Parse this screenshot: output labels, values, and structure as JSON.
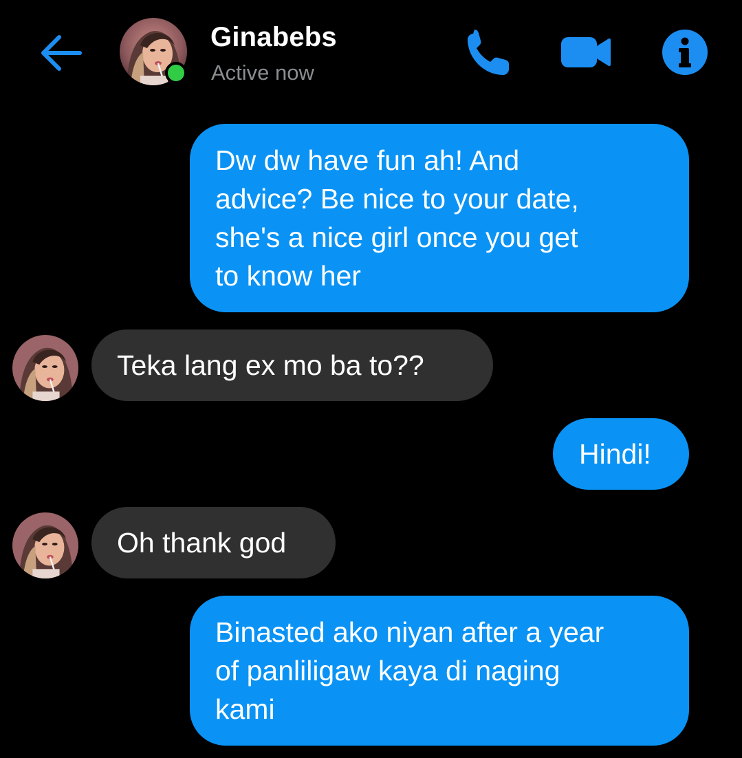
{
  "header": {
    "contact_name": "Ginabebs",
    "status": "Active now",
    "icons": {
      "back": "back-arrow-icon",
      "call": "phone-icon",
      "video": "video-camera-icon",
      "info": "info-icon"
    }
  },
  "colors": {
    "accent": "#0a93f5",
    "icon_blue": "#1c8ef2",
    "incoming_bubble": "#303030",
    "online": "#31cc46",
    "status_text": "#8a8d91",
    "background": "#000000"
  },
  "messages": [
    {
      "direction": "outgoing",
      "lines": [
        "Dw dw have fun ah! And",
        "advice? Be nice to your date,",
        "she's a nice girl once you get",
        "to know her"
      ]
    },
    {
      "direction": "incoming",
      "lines": [
        "Teka lang ex mo ba to??"
      ]
    },
    {
      "direction": "outgoing",
      "lines": [
        "Hindi!"
      ]
    },
    {
      "direction": "incoming",
      "lines": [
        "Oh thank god"
      ]
    },
    {
      "direction": "outgoing",
      "lines": [
        "Binasted ako niyan after a year",
        "of panliligaw kaya di naging",
        "kami"
      ]
    }
  ]
}
